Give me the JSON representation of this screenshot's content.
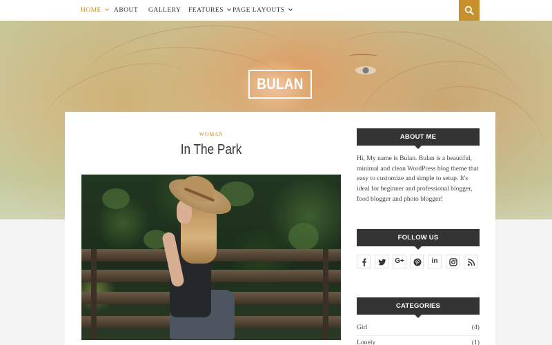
{
  "nav": {
    "items": [
      {
        "label": "HOME",
        "active": true,
        "has_dropdown": true
      },
      {
        "label": "ABOUT",
        "active": false,
        "has_dropdown": false
      },
      {
        "label": "GALLERY",
        "active": false,
        "has_dropdown": false
      },
      {
        "label": "FEATURES",
        "active": false,
        "has_dropdown": true
      },
      {
        "label": "PAGE LAYOUTS",
        "active": false,
        "has_dropdown": true
      }
    ],
    "search_icon": "search-icon"
  },
  "hero": {
    "logo": "BULAN"
  },
  "post": {
    "category": "WOMAN",
    "title": "In The Park"
  },
  "sidebar": {
    "about": {
      "heading": "ABOUT ME",
      "text": "Hi, My name is Bulan. Bulan is a beautiful, minimal and clean WordPress blog theme that easy to customize and simple to setup. It's ideal for beginner and professional blogger, food blogger and photo blogger!"
    },
    "follow": {
      "heading": "FOLLOW US",
      "icons": [
        "facebook-icon",
        "twitter-icon",
        "google-plus-icon",
        "pinterest-icon",
        "linkedin-icon",
        "instagram-icon",
        "rss-icon"
      ],
      "google_plus_label": "G+",
      "linkedin_label": "in"
    },
    "categories": {
      "heading": "CATEGORIES",
      "items": [
        {
          "name": "Girl",
          "count": "(4)"
        },
        {
          "name": "Lonely",
          "count": "(1)"
        }
      ]
    }
  },
  "colors": {
    "accent": "#c8902c",
    "widget_header": "#333333",
    "card": "#ffffff"
  }
}
